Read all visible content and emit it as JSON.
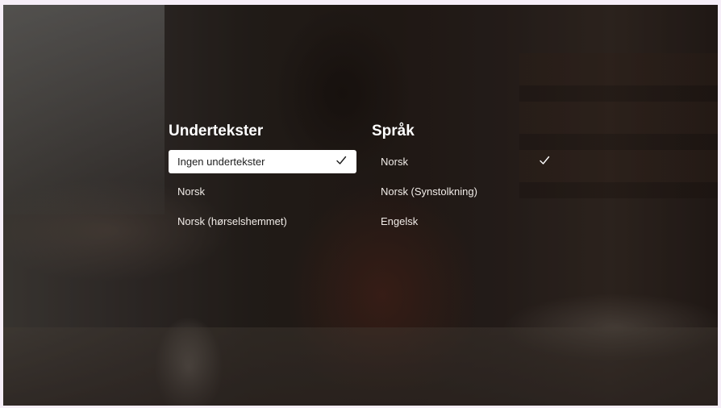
{
  "subtitles": {
    "heading": "Undertekster",
    "options": [
      {
        "label": "Ingen undertekster",
        "selected": true,
        "focused": true
      },
      {
        "label": "Norsk",
        "selected": false,
        "focused": false
      },
      {
        "label": "Norsk (hørselshemmet)",
        "selected": false,
        "focused": false
      }
    ]
  },
  "audio": {
    "heading": "Språk",
    "options": [
      {
        "label": "Norsk",
        "selected": true,
        "focused": false
      },
      {
        "label": "Norsk (Synstolkning)",
        "selected": false,
        "focused": false
      },
      {
        "label": "Engelsk",
        "selected": false,
        "focused": false
      }
    ]
  },
  "icons": {
    "selected_marker": "check-icon"
  },
  "colors": {
    "focused_background": "#ffffff",
    "focused_text": "#1c1c1c",
    "text": "#f1ece8",
    "check_on_dark": "#ffffff",
    "check_on_light": "#1c1c1c"
  }
}
